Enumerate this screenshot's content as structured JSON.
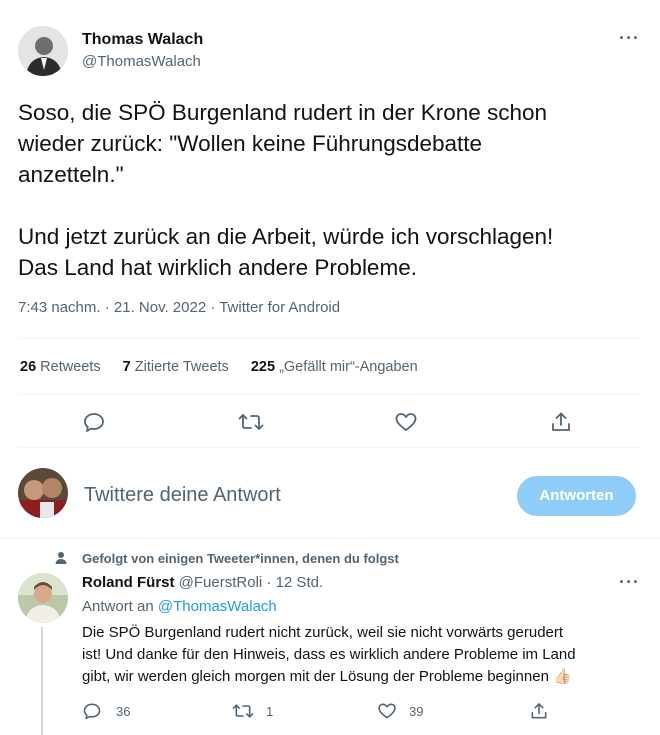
{
  "main_tweet": {
    "author_name": "Thomas Walach",
    "author_handle": "@ThomasWalach",
    "text_line1": "Soso, die SPÖ Burgenland rudert in der Krone schon",
    "text_line2": "wieder zurück: \"Wollen keine Führungsdebatte",
    "text_line3": "anzetteln.\"",
    "text_line4": "Und jetzt zurück an die Arbeit, würde ich vorschlagen!",
    "text_line5": "Das Land hat wirklich andere Probleme.",
    "meta": "7:43 nachm. · 21. Nov. 2022 · Twitter for Android",
    "stats": {
      "retweets_count": "26",
      "retweets_label": "Retweets",
      "quotes_count": "7",
      "quotes_label": "Zitierte Tweets",
      "likes_count": "225",
      "likes_label": "„Gefällt mir“-Angaben"
    }
  },
  "compose": {
    "placeholder": "Twittere deine Antwort",
    "button_label": "Antworten"
  },
  "reply": {
    "context": "Gefolgt von einigen Tweeter*innen, denen du folgst",
    "author_name": "Roland Fürst",
    "author_handle": "@FuerstRoli",
    "time": "· 12 Std.",
    "reply_to_prefix": "Antwort an",
    "reply_to_handle": "@ThomasWalach",
    "text_line1": "Die SPÖ Burgenland rudert nicht zurück, weil sie nicht vorwärts gerudert",
    "text_line2": "ist! Und danke für den Hinweis, dass es wirklich andere Probleme im Land",
    "text_line3": "gibt, wir werden gleich morgen mit der Lösung der Probleme beginnen 👍🏻",
    "reply_count": "36",
    "retweet_count": "1",
    "like_count": "39"
  },
  "more_icon": "···",
  "colors": {
    "accent": "#1d9bf0",
    "button_disabled": "#8ecdf7",
    "muted": "#536471"
  }
}
